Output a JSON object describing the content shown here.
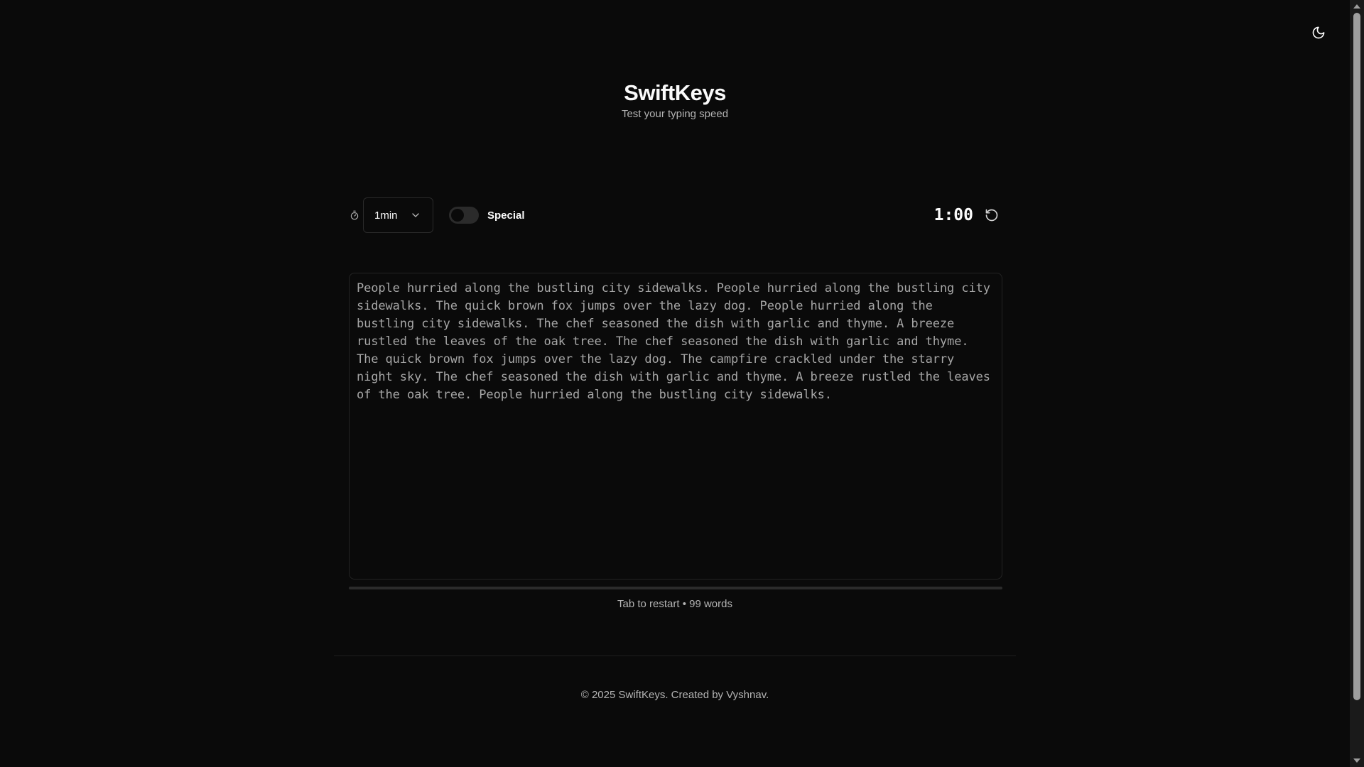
{
  "app": {
    "title": "SwiftKeys",
    "subtitle": "Test your typing speed"
  },
  "toolbar": {
    "timer_icon": "timer-icon",
    "duration_value": "1min",
    "special_label": "Special",
    "special_enabled": false,
    "countdown": "1:00",
    "restart_icon": "rotate-ccw-icon"
  },
  "theme_toggle": {
    "icon": "moon-icon"
  },
  "passage": {
    "text": "People hurried along the bustling city sidewalks. People hurried along the bustling city sidewalks. The quick brown fox jumps over the lazy dog. People hurried along the bustling city sidewalks. The chef seasoned the dish with garlic and thyme. A breeze rustled the leaves of the oak tree. The chef seasoned the dish with garlic and thyme. The quick brown fox jumps over the lazy dog. The campfire crackled under the starry night sky. The chef seasoned the dish with garlic and thyme. A breeze rustled the leaves of the oak tree. People hurried along the bustling city sidewalks.",
    "progress": 0
  },
  "hint": "Tab to restart • 99 words",
  "footer": {
    "copyright": "© 2025 SwiftKeys. Created by Vyshnav."
  },
  "colors": {
    "background": "#0a0a0a",
    "text": "#fafafa",
    "muted": "#b4b4b4",
    "passage": "#a6a6a6",
    "border": "#242424"
  }
}
